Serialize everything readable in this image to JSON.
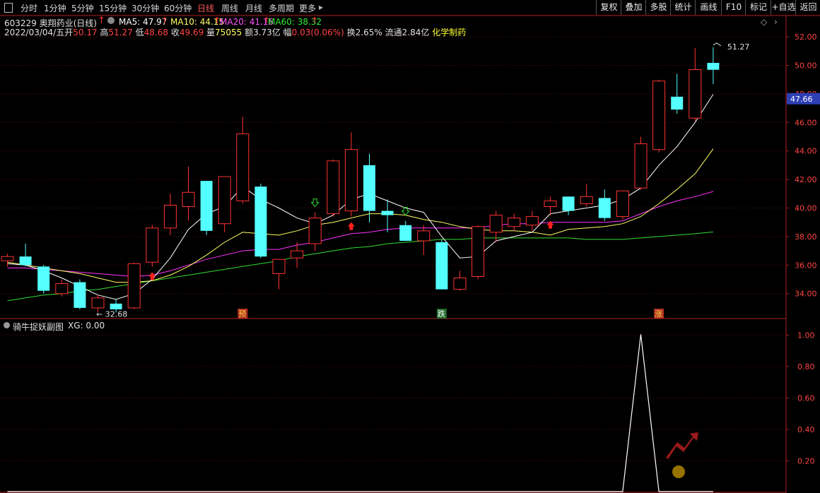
{
  "toolbar": {
    "periods": [
      "分时",
      "1分钟",
      "5分钟",
      "15分钟",
      "30分钟",
      "60分钟",
      "日线",
      "周线",
      "月线",
      "多周期",
      "更多"
    ],
    "active_period": "日线",
    "right_buttons": [
      "复权",
      "叠加",
      "多股",
      "统计",
      "画线",
      "F10",
      "标记",
      "+自选",
      "返回"
    ]
  },
  "header": {
    "code_name": "603229 奥翔药业(日线)",
    "ma5": "MA5: 47.97",
    "ma10": "MA10: 44.15",
    "ma20": "MA20: 41.16",
    "ma60": "MA60: 38.32",
    "date": "2022/03/04/五",
    "open_label": "开",
    "open_value": "50.17",
    "high_label": "高",
    "high_value": "51.27",
    "low_label": "低",
    "low_value": "48.68",
    "close_label": "收",
    "close_value": "49.69",
    "volume_label": "量",
    "volume_value": "75055",
    "amount_label": "额",
    "amount_value": "3.73亿",
    "range_label": "幅",
    "range_value": "0.03(0.06%)",
    "turnover": "换2.65%",
    "float_cap": "流通2.84亿",
    "industry": "化学制药"
  },
  "colors": {
    "up": "#ff3232",
    "down": "#54ffff",
    "ma5": "#ffffff",
    "ma10": "#ffff66",
    "ma20": "#ff33ff",
    "ma60": "#33dd33",
    "axis": "#b02020",
    "grid": "#5a1010",
    "label_pos": "#ff4444"
  },
  "main_chart": {
    "y_ticks": [
      "52.00",
      "50.00",
      "48.00",
      "46.00",
      "44.00",
      "42.00",
      "40.00",
      "38.00",
      "36.00",
      "34.00"
    ],
    "current_price_tag": "47.66",
    "max_annotation": "51.27",
    "min_annotation": "32.68",
    "markers": [
      {
        "text": "预",
        "bg": "#b03020",
        "color": "#ffd24a"
      },
      {
        "text": "跌",
        "bg": "#1f6b2b",
        "color": "#ffffff"
      },
      {
        "text": "涨",
        "bg": "#b03020",
        "color": "#ffd24a"
      }
    ]
  },
  "sub_chart": {
    "title": "骑牛捉妖副图",
    "xg_label": "XG: 0.00",
    "y_ticks": [
      "1.00",
      "0.80",
      "0.60",
      "0.40",
      "0.20"
    ]
  },
  "chart_data": {
    "type": "candlestick",
    "ylim": [
      32.6,
      52.4
    ],
    "candles": [
      {
        "o": 36.3,
        "h": 36.8,
        "l": 35.9,
        "c": 36.6
      },
      {
        "o": 36.6,
        "h": 37.5,
        "l": 35.9,
        "c": 36.0
      },
      {
        "o": 35.9,
        "h": 36.0,
        "l": 34.0,
        "c": 34.2
      },
      {
        "o": 34.0,
        "h": 35.0,
        "l": 33.8,
        "c": 34.7
      },
      {
        "o": 34.8,
        "h": 35.0,
        "l": 32.9,
        "c": 33.0
      },
      {
        "o": 33.0,
        "h": 33.9,
        "l": 32.7,
        "c": 33.7
      },
      {
        "o": 33.3,
        "h": 33.6,
        "l": 32.68,
        "c": 32.9
      },
      {
        "o": 33.0,
        "h": 36.2,
        "l": 32.9,
        "c": 36.1
      },
      {
        "o": 36.2,
        "h": 38.8,
        "l": 35.9,
        "c": 38.6
      },
      {
        "o": 38.6,
        "h": 41.0,
        "l": 38.1,
        "c": 40.2
      },
      {
        "o": 40.1,
        "h": 42.9,
        "l": 39.1,
        "c": 41.1
      },
      {
        "o": 41.9,
        "h": 41.9,
        "l": 38.1,
        "c": 38.4
      },
      {
        "o": 38.9,
        "h": 42.2,
        "l": 38.3,
        "c": 42.2
      },
      {
        "o": 40.5,
        "h": 46.4,
        "l": 40.3,
        "c": 45.2
      },
      {
        "o": 41.5,
        "h": 41.7,
        "l": 36.5,
        "c": 36.6
      },
      {
        "o": 35.4,
        "h": 36.1,
        "l": 34.3,
        "c": 36.4
      },
      {
        "o": 36.5,
        "h": 37.6,
        "l": 35.8,
        "c": 37.0
      },
      {
        "o": 37.5,
        "h": 39.7,
        "l": 37.0,
        "c": 39.3
      },
      {
        "o": 39.6,
        "h": 43.4,
        "l": 39.4,
        "c": 43.3
      },
      {
        "o": 39.8,
        "h": 45.3,
        "l": 39.4,
        "c": 44.1
      },
      {
        "o": 43.0,
        "h": 43.8,
        "l": 39.0,
        "c": 39.8
      },
      {
        "o": 39.8,
        "h": 40.6,
        "l": 38.3,
        "c": 39.5
      },
      {
        "o": 38.8,
        "h": 39.1,
        "l": 37.8,
        "c": 37.7
      },
      {
        "o": 37.7,
        "h": 38.8,
        "l": 36.7,
        "c": 38.4
      },
      {
        "o": 37.6,
        "h": 37.8,
        "l": 34.3,
        "c": 34.3
      },
      {
        "o": 34.3,
        "h": 35.6,
        "l": 34.2,
        "c": 35.1
      },
      {
        "o": 35.2,
        "h": 38.8,
        "l": 35.0,
        "c": 38.7
      },
      {
        "o": 38.3,
        "h": 39.8,
        "l": 37.6,
        "c": 39.5
      },
      {
        "o": 38.7,
        "h": 39.6,
        "l": 38.4,
        "c": 39.3
      },
      {
        "o": 38.8,
        "h": 39.8,
        "l": 38.4,
        "c": 39.4
      },
      {
        "o": 40.1,
        "h": 40.8,
        "l": 39.5,
        "c": 40.5
      },
      {
        "o": 40.8,
        "h": 40.8,
        "l": 39.5,
        "c": 39.8
      },
      {
        "o": 40.3,
        "h": 41.7,
        "l": 40.1,
        "c": 40.8
      },
      {
        "o": 40.7,
        "h": 41.3,
        "l": 39.1,
        "c": 39.3
      },
      {
        "o": 39.4,
        "h": 41.2,
        "l": 39.2,
        "c": 41.2
      },
      {
        "o": 41.4,
        "h": 45.0,
        "l": 41.3,
        "c": 44.5
      },
      {
        "o": 44.1,
        "h": 49.0,
        "l": 43.9,
        "c": 48.9
      },
      {
        "o": 47.8,
        "h": 49.4,
        "l": 46.6,
        "c": 46.9
      },
      {
        "o": 46.3,
        "h": 51.2,
        "l": 46.1,
        "c": 49.7
      },
      {
        "o": 50.17,
        "h": 51.27,
        "l": 48.68,
        "c": 49.69
      }
    ],
    "ma5": [
      36.1,
      36.0,
      35.6,
      35.1,
      34.5,
      33.9,
      33.6,
      34.0,
      35.0,
      36.5,
      38.5,
      39.6,
      40.1,
      41.5,
      40.6,
      40.0,
      39.3,
      38.9,
      39.5,
      40.6,
      41.0,
      40.5,
      40.0,
      39.7,
      38.0,
      36.5,
      36.6,
      37.7,
      38.0,
      38.3,
      39.6,
      39.8,
      40.0,
      40.2,
      40.6,
      41.4,
      43.0,
      44.3,
      46.0,
      47.97
    ],
    "ma10": [
      36.2,
      36.0,
      35.8,
      35.6,
      35.4,
      35.1,
      34.8,
      34.8,
      34.9,
      35.3,
      35.9,
      36.7,
      37.6,
      38.3,
      38.2,
      38.1,
      38.4,
      38.8,
      39.0,
      39.3,
      39.6,
      39.6,
      39.5,
      39.2,
      39.0,
      38.7,
      38.5,
      38.4,
      38.4,
      38.3,
      38.1,
      38.5,
      38.6,
      38.7,
      38.9,
      39.4,
      40.3,
      41.3,
      42.4,
      44.15
    ],
    "ma20": [
      35.8,
      35.8,
      35.7,
      35.6,
      35.5,
      35.4,
      35.3,
      35.2,
      35.3,
      35.6,
      36.0,
      36.4,
      36.7,
      37.0,
      37.1,
      37.1,
      37.4,
      37.6,
      37.9,
      38.2,
      38.3,
      38.5,
      38.6,
      38.6,
      38.6,
      38.6,
      38.6,
      38.8,
      38.9,
      38.9,
      39.0,
      39.0,
      39.0,
      39.0,
      39.1,
      39.6,
      40.1,
      40.5,
      40.8,
      41.16
    ],
    "ma60": [
      33.5,
      33.7,
      33.9,
      34.0,
      34.2,
      34.3,
      34.5,
      34.7,
      34.9,
      35.1,
      35.3,
      35.5,
      35.7,
      35.9,
      36.1,
      36.3,
      36.6,
      36.8,
      37.0,
      37.2,
      37.3,
      37.5,
      37.6,
      37.7,
      37.8,
      37.8,
      37.9,
      37.9,
      37.9,
      37.9,
      37.9,
      37.9,
      37.8,
      37.8,
      37.8,
      37.9,
      38.0,
      38.1,
      38.2,
      38.32
    ],
    "xg": [
      0,
      0,
      0,
      0,
      0,
      0,
      0,
      0,
      0,
      0,
      0,
      0,
      0,
      0,
      0,
      0,
      0,
      0,
      0,
      0,
      0,
      0,
      0,
      0,
      0,
      0,
      0,
      0,
      0,
      0,
      0,
      0,
      0,
      0,
      0,
      1,
      0,
      0,
      0,
      0
    ],
    "sub_ylim": [
      0,
      1.1
    ]
  }
}
